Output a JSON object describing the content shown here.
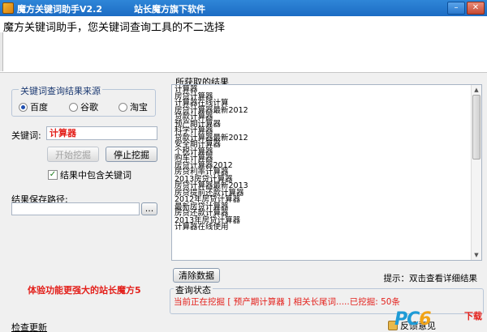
{
  "window": {
    "title": "魔方关键词助手V2.2",
    "subtitle": "站长魔方旗下软件"
  },
  "banner": {
    "text": "魔方关键词助手，您关键词查询工具的不二选择"
  },
  "source_group": {
    "legend": "关键词查询结果来源",
    "options": [
      {
        "label": "百度",
        "selected": true
      },
      {
        "label": "谷歌",
        "selected": false
      },
      {
        "label": "淘宝",
        "selected": false
      }
    ]
  },
  "keyword": {
    "label": "关键词:",
    "value": "计算器",
    "value_color": "#e3201b"
  },
  "buttons": {
    "start": "开始挖掘",
    "stop": "停止挖掘",
    "clear": "清除数据",
    "browse": "..."
  },
  "include_keyword": {
    "label": "结果中包含关键词",
    "checked": true
  },
  "save_path": {
    "label": "结果保存路径:",
    "value": ""
  },
  "promo": "体验功能更强大的站长魔方5",
  "results": {
    "legend": "所获取的结果",
    "items": [
      "计算器",
      "房贷计算器",
      "计算器在线计算",
      "房贷计算器最新2012",
      "贷款计算器",
      "预产期计算器",
      "科学计算器",
      "贷款计算器最新2012",
      "安全期计算器",
      "个税计算器",
      "购车计算器",
      "房贷计算器2012",
      "房贷利率计算器",
      "2013房贷计算器",
      "房贷计算器最新2013",
      "房贷提前还款计算器",
      "2012年房贷计算器",
      "最新房贷计算器",
      "房贷还款计算器",
      "2013年房贷计算器",
      "计算器在线使用"
    ],
    "hint": "提示：双击查看详细结果"
  },
  "status": {
    "legend": "查询状态",
    "text": "当前正在挖掘 [ 预产期计算器 ] 相关长尾词.....已挖掘:  50条"
  },
  "footer": {
    "update_link": "检查更新",
    "feedback": "反馈意见"
  },
  "watermark": {
    "letters_a": "PC",
    "letters_b": "6",
    "cn": "下载"
  },
  "colors": {
    "titlebar": "#1c6cc4",
    "accent_red": "#e3201b",
    "legend_blue": "#1c3a72"
  }
}
